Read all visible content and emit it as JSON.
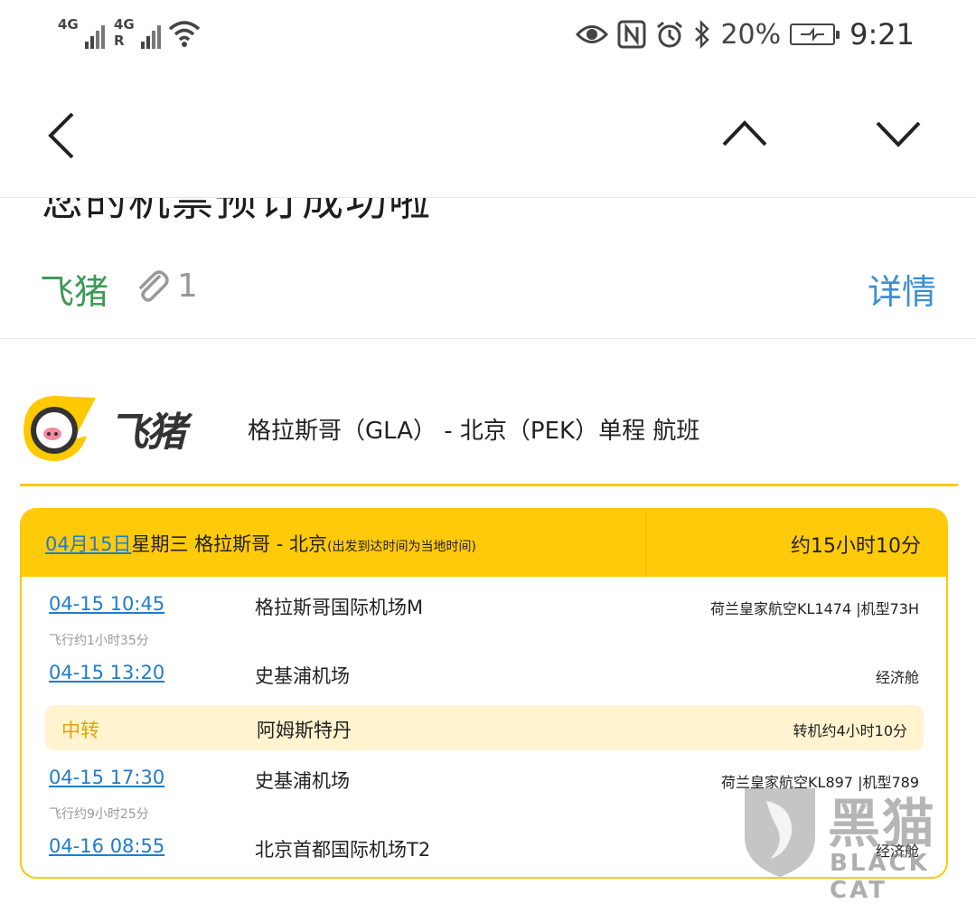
{
  "status_bar": {
    "signal1": "4G",
    "signal2": "4G R",
    "icons": [
      "signal-icon",
      "wifi-icon",
      "eye-icon",
      "nfc-icon",
      "alarm-icon",
      "bluetooth-icon",
      "battery-charging-icon"
    ],
    "battery": "20%",
    "time": "9:21"
  },
  "nav": {
    "back_icon": "chevron-left-icon",
    "prev_icon": "chevron-up-icon",
    "next_icon": "chevron-down-icon"
  },
  "mail": {
    "subject": "您的机票预订成功啦",
    "sender": "飞猪",
    "attachment_count": "1",
    "details_link": "详情"
  },
  "brand": {
    "name": "飞猪",
    "route_title": "格拉斯哥（GLA） - 北京（PEK）单程 航班"
  },
  "itinerary": {
    "date": "04月15日",
    "header_rest": "星期三 格拉斯哥 - 北京",
    "header_note": "(出发到达时间为当地时间)",
    "total_duration": "约15小时10分",
    "seg1": {
      "dep_time": "04-15 10:45",
      "dep_airport": "格拉斯哥国际机场M",
      "flight": "荷兰皇家航空KL1474 |机型73H",
      "duration": "飞行约1小时35分",
      "arr_time": "04-15 13:20",
      "arr_airport": "史基浦机场",
      "cabin": "经济舱"
    },
    "transfer": {
      "label": "中转",
      "city": "阿姆斯特丹",
      "wait": "转机约4小时10分"
    },
    "seg2": {
      "dep_time": "04-15 17:30",
      "dep_airport": "史基浦机场",
      "flight": "荷兰皇家航空KL897 |机型789",
      "duration": "飞行约9小时25分",
      "arr_time": "04-16 08:55",
      "arr_airport": "北京首都国际机场T2",
      "cabin": "经济舱"
    }
  },
  "watermark": {
    "cn": "黑猫",
    "en": "BLACK CAT"
  },
  "colors": {
    "accent_yellow": "#ffca0a",
    "link_blue": "#1f7ccc",
    "sender_green": "#3b9a55",
    "transfer_bg": "#fff4cf"
  }
}
